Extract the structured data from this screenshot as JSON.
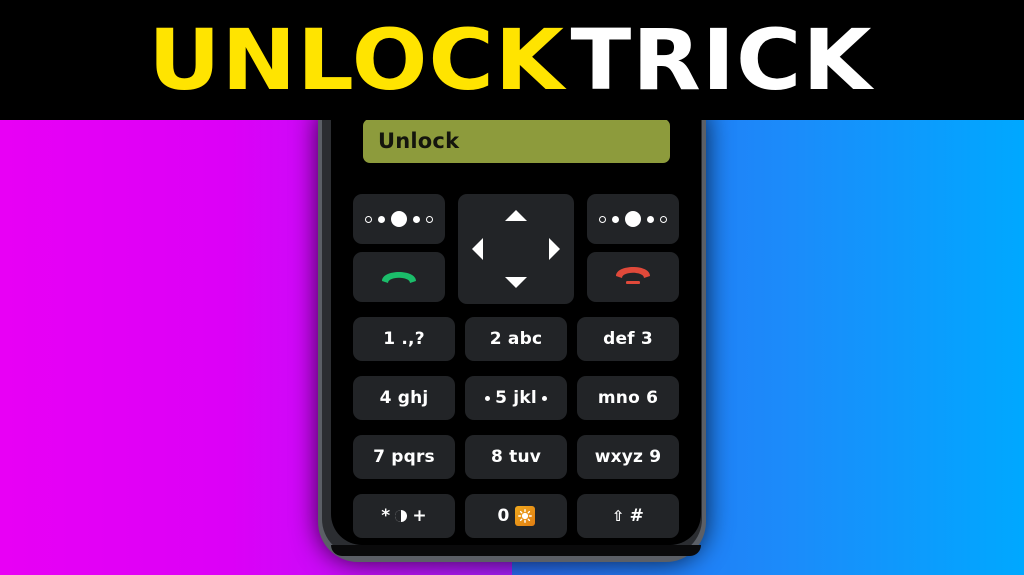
{
  "banner": {
    "words": [
      {
        "text": "UNLOCK",
        "color": "#ffe400"
      },
      {
        "text": "TRICK",
        "color": "#ffffff"
      }
    ],
    "background": "#000000"
  },
  "background": {
    "left_gradient_from": "#e800f5",
    "left_gradient_to": "#9b1fff",
    "right_gradient_from": "#2a6bf2",
    "right_gradient_to": "#00a8ff"
  },
  "phone": {
    "frame_color": "#5b5f66",
    "screen_background": "#000000",
    "unlock_bar": {
      "label": "Unlock",
      "background": "#8d9b3c",
      "text_color": "#14150d"
    },
    "nav": {
      "softkey_left": {
        "icon": "dots-indicator-icon"
      },
      "softkey_right": {
        "icon": "dots-indicator-icon"
      },
      "call_button": {
        "icon": "phone-handset-green-icon",
        "color": "#1bbd6a"
      },
      "end_call_button": {
        "icon": "phone-handset-red-icon",
        "color": "#e0493a"
      },
      "dpad": {
        "up": "dpad-up-icon",
        "down": "dpad-down-icon",
        "left": "dpad-left-icon",
        "right": "dpad-right-icon"
      }
    },
    "keypad": {
      "keys": [
        {
          "id": "key-1",
          "label": "1 .,?",
          "type": "text"
        },
        {
          "id": "key-2",
          "label": "2 abc",
          "type": "text"
        },
        {
          "id": "key-3",
          "label": "def 3",
          "type": "text"
        },
        {
          "id": "key-4",
          "label": "4 ghj",
          "type": "text"
        },
        {
          "id": "key-5",
          "label": "5 jkl",
          "type": "dotted",
          "lead": "•",
          "trail": "•"
        },
        {
          "id": "key-6",
          "label": "mno 6",
          "type": "text"
        },
        {
          "id": "key-7",
          "label": "7 pqrs",
          "type": "text"
        },
        {
          "id": "key-8",
          "label": "8 tuv",
          "type": "text"
        },
        {
          "id": "key-9",
          "label": "wxyz 9",
          "type": "text"
        },
        {
          "id": "key-star",
          "label_left": "*",
          "label_right": "+",
          "type": "star",
          "icon": "contrast-half-circle-icon"
        },
        {
          "id": "key-0",
          "label_left": "0",
          "type": "zero",
          "icon": "flashlight-sun-icon",
          "icon_color": "#eb9716"
        },
        {
          "id": "key-hash",
          "label_right": "#",
          "type": "hash",
          "icon": "shift-arrow-icon"
        }
      ]
    }
  }
}
